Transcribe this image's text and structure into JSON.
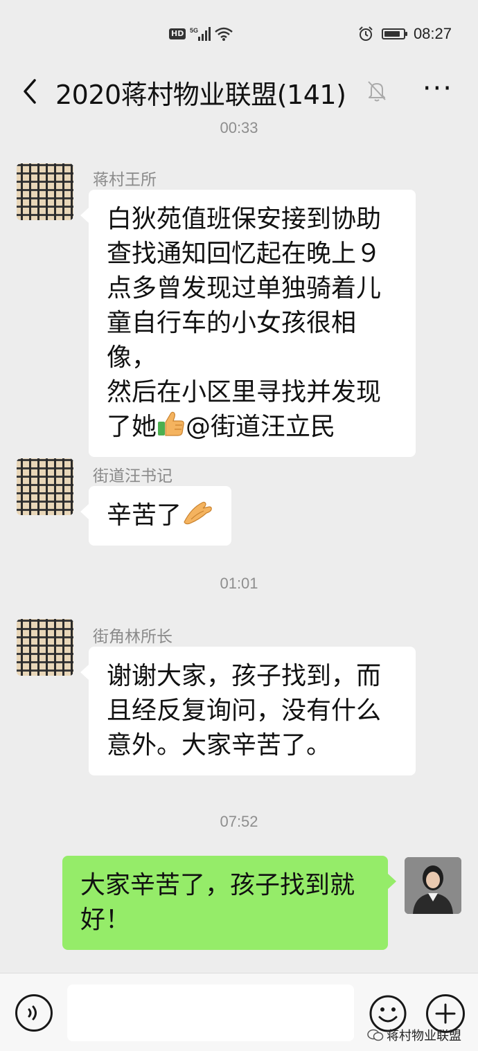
{
  "status_bar": {
    "hd_label": "HD",
    "network_label": "5G",
    "time": "08:27",
    "battery_level": 0.85
  },
  "header": {
    "title": "2020蒋村物业联盟(141)",
    "icons": [
      "back-icon",
      "mute-bell-icon",
      "more-icon"
    ]
  },
  "messages": [
    {
      "type": "timestamp",
      "text": "00:33"
    },
    {
      "type": "incoming",
      "sender": "蒋村王所",
      "lines": [
        "白狄苑值班保安接到协助",
        "查找通知回忆起在晚上９",
        "点多曾发现过单独骑着儿",
        "童自行车的小女孩很相像，",
        "然后在小区里寻找并发现"
      ],
      "last_line_before": "了她",
      "emoji": "thumbs-up-icon",
      "last_line_after": "@街道汪立民"
    },
    {
      "type": "incoming",
      "sender": "街道汪书记",
      "text": "辛苦了",
      "emoji": "clapping-hands-icon"
    },
    {
      "type": "timestamp",
      "text": "01:01"
    },
    {
      "type": "incoming",
      "sender": "街角林所长",
      "lines": [
        "谢谢大家，孩子找到，而",
        "且经反复询问，没有什么",
        "意外。大家辛苦了。"
      ]
    },
    {
      "type": "timestamp",
      "text": "07:52"
    },
    {
      "type": "outgoing",
      "lines": [
        "大家辛苦了，孩子找到就",
        "好！"
      ]
    }
  ],
  "input_bar": {
    "icons": [
      "voice-icon",
      "emoji-icon",
      "plus-icon"
    ],
    "watermark": "蒋村物业联盟"
  }
}
